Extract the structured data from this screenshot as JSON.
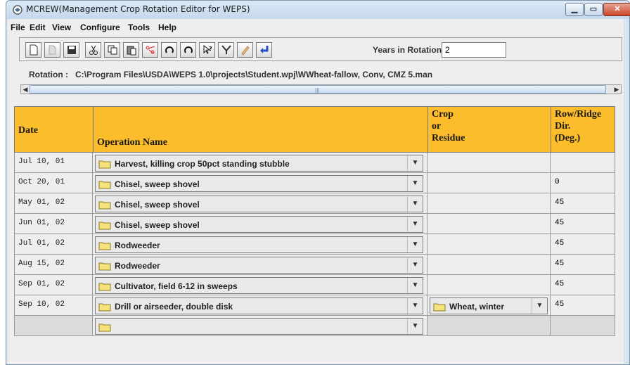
{
  "window": {
    "title": "MCREW(Management Crop Rotation Editor for WEPS)"
  },
  "menu": [
    {
      "label": "File"
    },
    {
      "label": "Edit"
    },
    {
      "label": "View"
    },
    {
      "label": "Configure"
    },
    {
      "label": "Tools"
    },
    {
      "label": "Help"
    }
  ],
  "toolbar": {
    "icons": [
      "new-file-icon",
      "open-file-icon",
      "save-icon",
      "cut-icon",
      "copy-icon",
      "paste-icon",
      "scissors-red-icon",
      "rotate-left-icon",
      "rotate-right-icon",
      "help-cursor-icon",
      "filter-icon",
      "pencil-icon",
      "enter-arrow-icon"
    ],
    "years_label": "Years in Rotation:",
    "years_value": "2"
  },
  "rotation": {
    "label": "Rotation :",
    "path": "C:\\Program Files\\USDA\\WEPS 1.0\\projects\\Student.wpj\\WWheat-fallow, Conv, CMZ 5.man"
  },
  "table": {
    "headers": {
      "date": "Date",
      "operation": "Operation Name",
      "crop_1": "Crop",
      "crop_2": "or",
      "crop_3": "Residue",
      "dir_1": "Row/Ridge",
      "dir_2": "Dir.",
      "dir_3": "(Deg.)"
    },
    "rows": [
      {
        "date": "Jul 10, 01",
        "operation": "Harvest, killing crop 50pct standing stubble",
        "crop": "",
        "dir": ""
      },
      {
        "date": "Oct 20, 01",
        "operation": "Chisel, sweep shovel",
        "crop": "",
        "dir": "0"
      },
      {
        "date": "May 01, 02",
        "operation": "Chisel, sweep shovel",
        "crop": "",
        "dir": "45"
      },
      {
        "date": "Jun 01, 02",
        "operation": "Chisel, sweep shovel",
        "crop": "",
        "dir": "45"
      },
      {
        "date": "Jul 01, 02",
        "operation": "Rodweeder",
        "crop": "",
        "dir": "45"
      },
      {
        "date": "Aug 15, 02",
        "operation": "Rodweeder",
        "crop": "",
        "dir": "45"
      },
      {
        "date": "Sep 01, 02",
        "operation": "Cultivator, field 6-12 in sweeps",
        "crop": "",
        "dir": "45"
      },
      {
        "date": "Sep 10, 02",
        "operation": "Drill or airseeder, double disk",
        "crop": "Wheat, winter",
        "dir": "45"
      },
      {
        "date": "",
        "operation": "",
        "crop": "",
        "dir": ""
      }
    ]
  },
  "colors": {
    "header_bg": "#fbbd2c",
    "folder": "#f5e27a"
  }
}
